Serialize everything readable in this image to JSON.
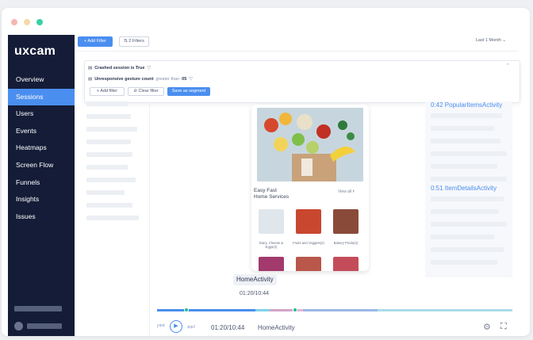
{
  "app": {
    "logo": "uxcam"
  },
  "sidebar": {
    "items": [
      {
        "label": "Overview",
        "active": false
      },
      {
        "label": "Sessions",
        "active": true
      },
      {
        "label": "Users",
        "active": false
      },
      {
        "label": "Events",
        "active": false
      },
      {
        "label": "Heatmaps",
        "active": false
      },
      {
        "label": "Screen Flow",
        "active": false
      },
      {
        "label": "Funnels",
        "active": false
      },
      {
        "label": "Insights",
        "active": false
      },
      {
        "label": "Issues",
        "active": false
      }
    ]
  },
  "toolbar": {
    "add_filter": "+ Add Filter",
    "filters": "2 Filters",
    "date_range": "Last 1 Month"
  },
  "filters": {
    "line1_bold": "Crashed session is True",
    "line2_bold": "Unresponsive gesture count",
    "line2_op": "greater than",
    "line2_value": "05",
    "add_filter": "+ Add filter",
    "clear_filter": "Clear filter",
    "save_segment": "Save as segment"
  },
  "phone": {
    "title_line1": "Easy Fast",
    "title_line2": "Home Services",
    "view_all": "View all",
    "products": [
      "Dairy, Cheese & Eggs(2)",
      "Fruits and Veggies(2)",
      "Bakery Produ(2)"
    ]
  },
  "activities": [
    "0:42 PopularItemsActivity",
    "0:51 ItemDetailsActivity"
  ],
  "player": {
    "screen_badge": "HomeActivity",
    "badge_time": "01:20/10:44",
    "time": "01:20/10:44",
    "screen": "HomeActivity"
  },
  "colors": {
    "accent": "#4a8ef0",
    "sidebar": "#141c37"
  }
}
